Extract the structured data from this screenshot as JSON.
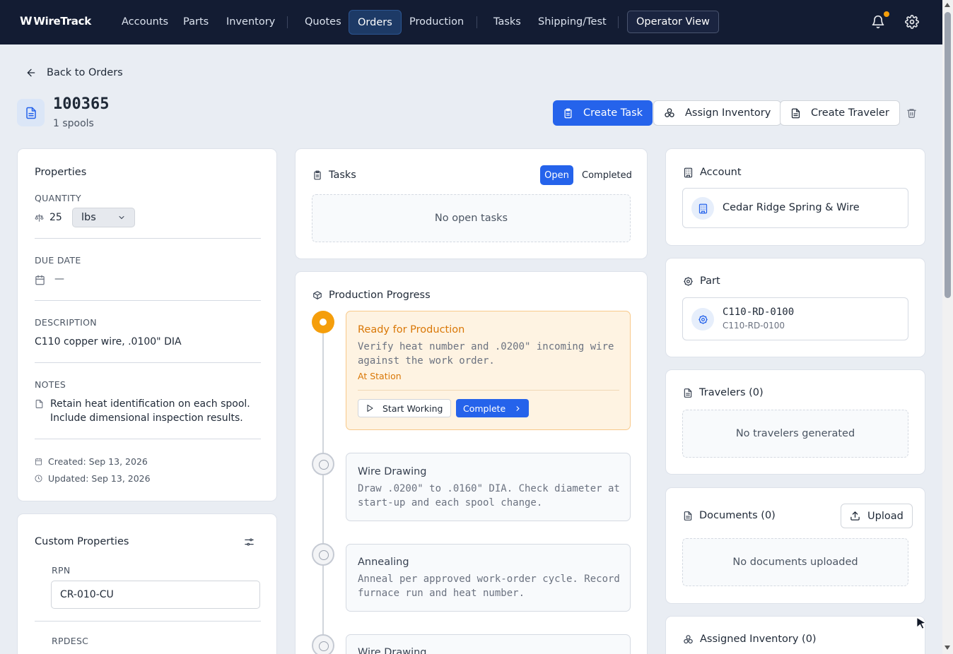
{
  "nav": {
    "logo": "WireTrack",
    "items": [
      "Accounts",
      "Parts",
      "Inventory",
      "Quotes",
      "Orders",
      "Production",
      "Tasks",
      "Shipping/Test"
    ],
    "active": "Orders",
    "operator_view": "Operator View",
    "notification_color": "#f59e0b"
  },
  "header": {
    "back_label": "Back to Orders",
    "order_number": "100365",
    "subtitle": "1 spools",
    "create_task": "Create Task",
    "assign_inventory": "Assign Inventory",
    "create_traveler": "Create Traveler"
  },
  "properties": {
    "title": "Properties",
    "quantity_label": "QUANTITY",
    "quantity_value": "25",
    "quantity_unit": "lbs",
    "due_date_label": "DUE DATE",
    "due_date_value": "—",
    "description_label": "DESCRIPTION",
    "description_value": "C110 copper wire, .0100\" DIA",
    "notes_label": "NOTES",
    "notes_line1": "Retain heat identification on each spool.",
    "notes_line2": "Include dimensional inspection results.",
    "created": "Created: Sep 13, 2026",
    "updated": "Updated: Sep 13, 2026"
  },
  "custom_properties": {
    "title": "Custom Properties",
    "rpn_label": "RPN",
    "rpn_value": "CR-010-CU",
    "rpdesc_label": "RPDESC"
  },
  "tasks": {
    "title": "Tasks",
    "tab_open": "Open",
    "tab_completed": "Completed",
    "empty": "No open tasks"
  },
  "production": {
    "title": "Production Progress",
    "steps": [
      {
        "name": "Ready for Production",
        "desc_line1": "Verify heat number and .0200\" incoming wire",
        "desc_line2": "against the work order.",
        "status": "At Station",
        "start_label": "Start Working",
        "complete_label": "Complete"
      },
      {
        "name": "Wire Drawing",
        "desc_line1": "Draw .0200\" to .0160\" DIA. Check diameter at",
        "desc_line2": "start-up and each spool change."
      },
      {
        "name": "Annealing",
        "desc_line1": "Anneal per approved work-order cycle. Record",
        "desc_line2": "furnace run and heat number."
      },
      {
        "name": "Wire Drawing"
      }
    ]
  },
  "account": {
    "title": "Account",
    "name": "Cedar Ridge Spring & Wire"
  },
  "part": {
    "title": "Part",
    "number": "C110-RD-0100",
    "sub": "C110-RD-0100"
  },
  "travelers": {
    "title": "Travelers (0)",
    "empty": "No travelers generated"
  },
  "documents": {
    "title": "Documents (0)",
    "upload": "Upload",
    "empty": "No documents uploaded"
  },
  "assigned_inventory": {
    "title": "Assigned Inventory (0)"
  },
  "colors": {
    "primary": "#2563eb",
    "nav_bg": "#131c33",
    "active_step": "#f59e0b"
  }
}
